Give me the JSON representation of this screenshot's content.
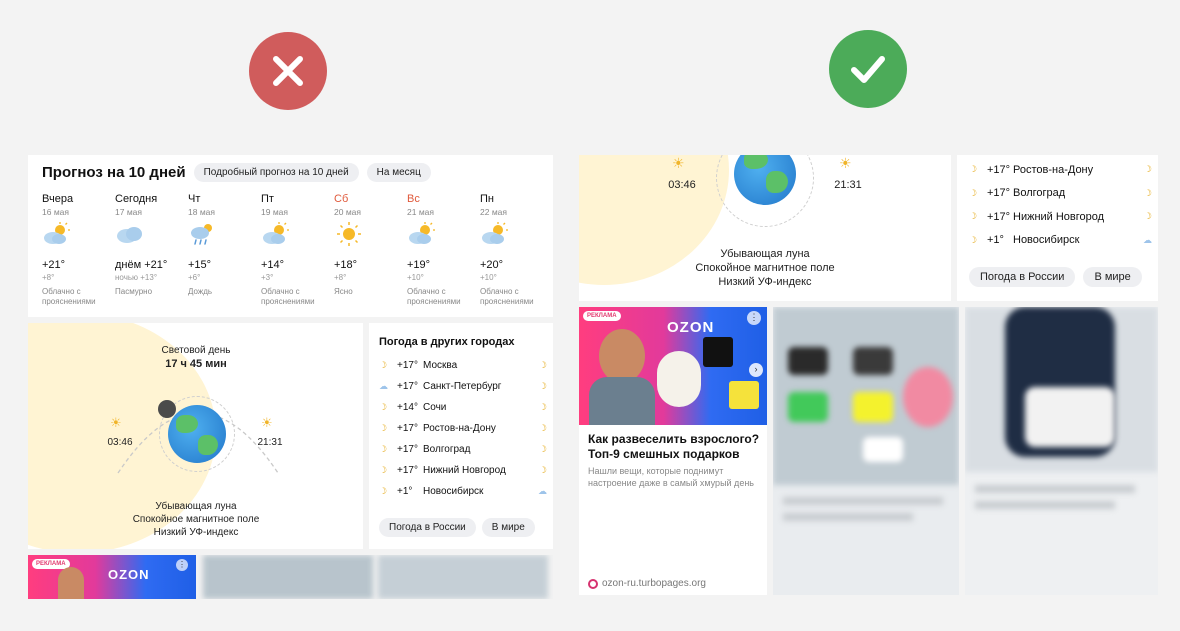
{
  "marks": {
    "bad": "cross-icon",
    "good": "check-icon",
    "bad_color": "#d05c5c",
    "good_color": "#4cab59"
  },
  "forecast": {
    "title": "Прогноз на 10 дней",
    "chip1": "Подробный прогноз на 10 дней",
    "chip2": "На месяц",
    "days": [
      {
        "name": "Вчера",
        "date": "16 мая",
        "icon": "sun-cloud",
        "temp": "+21°",
        "night": "+8°",
        "cond": "Облачно с прояснениями"
      },
      {
        "name": "Сегодня",
        "date": "17 мая",
        "icon": "cloud",
        "temp": "днём +21°",
        "night": "ночью +13°",
        "cond": "Пасмурно"
      },
      {
        "name": "Чт",
        "date": "18 мая",
        "icon": "rain",
        "temp": "+15°",
        "night": "+6°",
        "cond": "Дождь"
      },
      {
        "name": "Пт",
        "date": "19 мая",
        "icon": "sun-cloud",
        "temp": "+14°",
        "night": "+3°",
        "cond": "Облачно с прояснениями"
      },
      {
        "name": "Сб",
        "date": "20 мая",
        "icon": "sun",
        "temp": "+18°",
        "night": "+8°",
        "cond": "Ясно"
      },
      {
        "name": "Вс",
        "date": "21 мая",
        "icon": "sun-cloud",
        "temp": "+19°",
        "night": "+10°",
        "cond": "Облачно с прояснениями"
      },
      {
        "name": "Пн",
        "date": "22 мая",
        "icon": "sun-cloud",
        "temp": "+20°",
        "night": "+10°",
        "cond": "Облачно с прояснениями"
      }
    ]
  },
  "sun": {
    "daylight_label": "Световой день",
    "daylight_value": "17 ч 45 мин",
    "sunrise": "03:46",
    "sunset": "21:31",
    "moon": "Убывающая луна",
    "magnetic": "Спокойное магнитное поле",
    "uv": "Низкий УФ-индекс"
  },
  "cities": {
    "title": "Погода в других городах",
    "list": [
      {
        "temp": "+17°",
        "city": "Москва"
      },
      {
        "temp": "+17°",
        "city": "Санкт-Петербург"
      },
      {
        "temp": "+14°",
        "city": "Сочи"
      },
      {
        "temp": "+17°",
        "city": "Ростов-на-Дону"
      },
      {
        "temp": "+17°",
        "city": "Волгоград"
      },
      {
        "temp": "+17°",
        "city": "Нижний Новгород"
      },
      {
        "temp": "+1°",
        "city": "Новосибирск"
      }
    ],
    "btn_russia": "Погода в России",
    "btn_world": "В мире"
  },
  "ad": {
    "badge": "РЕКЛАМА",
    "brand": "OZON",
    "title": "Как развеселить взрослого? Топ-9 смешных подарков",
    "desc": "Нашли вещи, которые поднимут настроение даже в самый хмурый день",
    "source": "ozon-ru.turbopages.org"
  }
}
